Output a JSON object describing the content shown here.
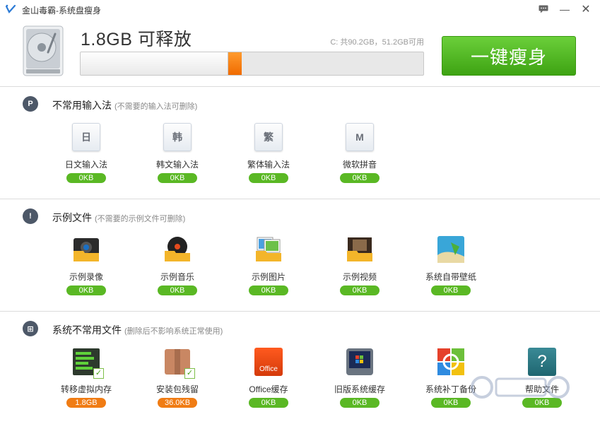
{
  "window": {
    "title": "金山毒霸-系统盘瘦身",
    "feedback_icon": "feedback-icon",
    "minimize_label": "—",
    "close_label": "✕"
  },
  "header": {
    "release_text": "1.8GB 可释放",
    "disk_info": "C: 共90.2GB，51.2GB可用",
    "used_fraction": 0.43,
    "free_fraction": 0.04,
    "slim_button": "一键瘦身"
  },
  "sections": [
    {
      "title": "不常用输入法",
      "subtitle": "(不需要的输入法可删除)",
      "icon_glyph": "P",
      "items": [
        {
          "label": "日文输入法",
          "size": "0KB",
          "icon": "日"
        },
        {
          "label": "韩文输入法",
          "size": "0KB",
          "icon": "韩"
        },
        {
          "label": "繁体输入法",
          "size": "0KB",
          "icon": "繁"
        },
        {
          "label": "微软拼音",
          "size": "0KB",
          "icon": "M"
        }
      ]
    },
    {
      "title": "示例文件",
      "subtitle": "(不需要的示例文件可删除)",
      "icon_glyph": "!",
      "items": [
        {
          "label": "示例录像",
          "size": "0KB"
        },
        {
          "label": "示例音乐",
          "size": "0KB"
        },
        {
          "label": "示例图片",
          "size": "0KB"
        },
        {
          "label": "示例视频",
          "size": "0KB"
        },
        {
          "label": "系统自带壁纸",
          "size": "0KB"
        }
      ]
    },
    {
      "title": "系统不常用文件",
      "subtitle": "(删除后不影响系统正常使用)",
      "icon_glyph": "⊞",
      "items": [
        {
          "label": "转移虚拟内存",
          "size": "1.8GB"
        },
        {
          "label": "安装包残留",
          "size": "36.0KB"
        },
        {
          "label": "Office缓存",
          "size": "0KB",
          "icon_text": "Office"
        },
        {
          "label": "旧版系统缓存",
          "size": "0KB"
        },
        {
          "label": "系统补丁备份",
          "size": "0KB"
        },
        {
          "label": "帮助文件",
          "size": "0KB",
          "icon_text": "?"
        }
      ]
    }
  ],
  "colors": {
    "accent_green": "#5ab824",
    "warn_orange": "#f07c14",
    "button_green": "#4cb21e"
  }
}
